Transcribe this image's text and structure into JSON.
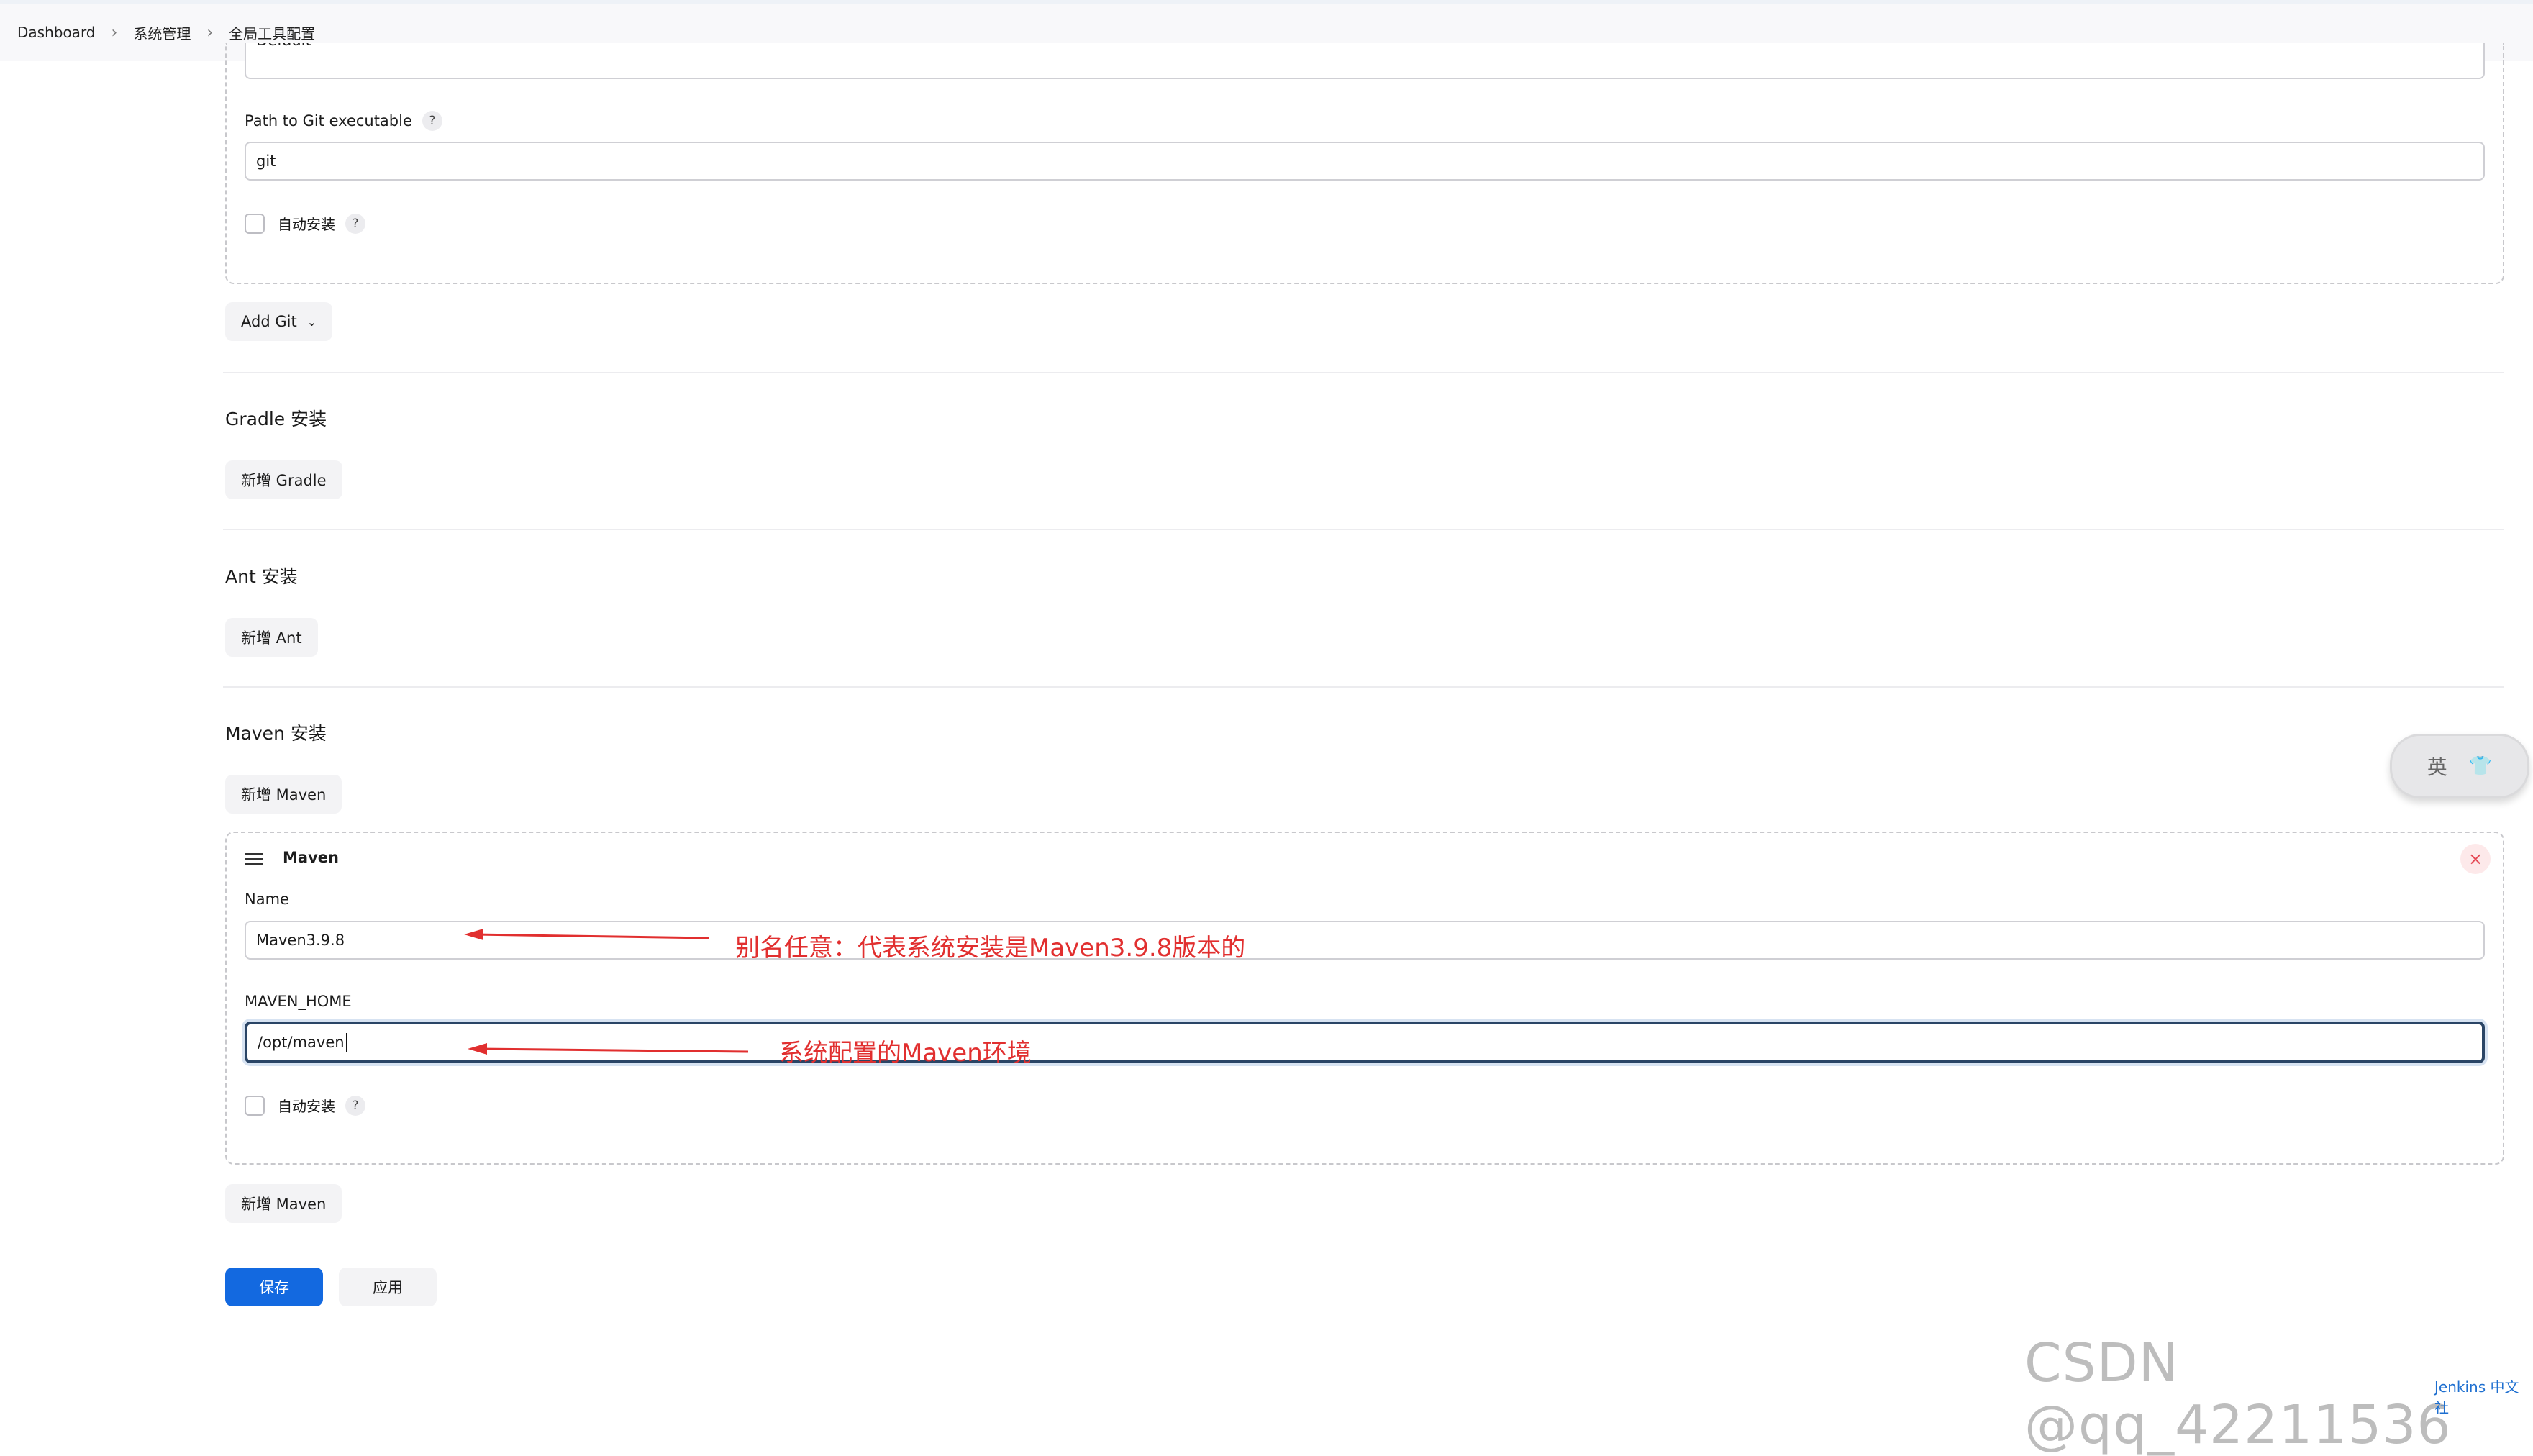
{
  "breadcrumb": [
    "Dashboard",
    "系统管理",
    "全局工具配置"
  ],
  "git": {
    "top_field_value": "Default",
    "path_label": "Path to Git executable",
    "path_value": "git",
    "auto_install_label": "自动安装",
    "help": "?",
    "add_git_label": "Add Git"
  },
  "gradle": {
    "title": "Gradle 安装",
    "add_label": "新增 Gradle"
  },
  "ant": {
    "title": "Ant 安装",
    "add_label": "新增 Ant"
  },
  "maven": {
    "title": "Maven 安装",
    "add_label": "新增 Maven",
    "panel_title": "Maven",
    "name_label": "Name",
    "name_value": "Maven3.9.8",
    "home_label": "MAVEN_HOME",
    "home_value": "/opt/maven",
    "auto_install_label": "自动安装",
    "close_symbol": "×",
    "add_label_bottom": "新增 Maven"
  },
  "actions": {
    "save": "保存",
    "apply": "应用"
  },
  "annotations": {
    "name_note": "别名任意：代表系统安装是Maven3.9.8版本的",
    "home_note": "系统配置的Maven环境",
    "color": "#e12f2f"
  },
  "ime_widget": {
    "text": "英"
  },
  "watermark": "CSDN @qq_42211536",
  "footer_tag": "Jenkins 中文社"
}
